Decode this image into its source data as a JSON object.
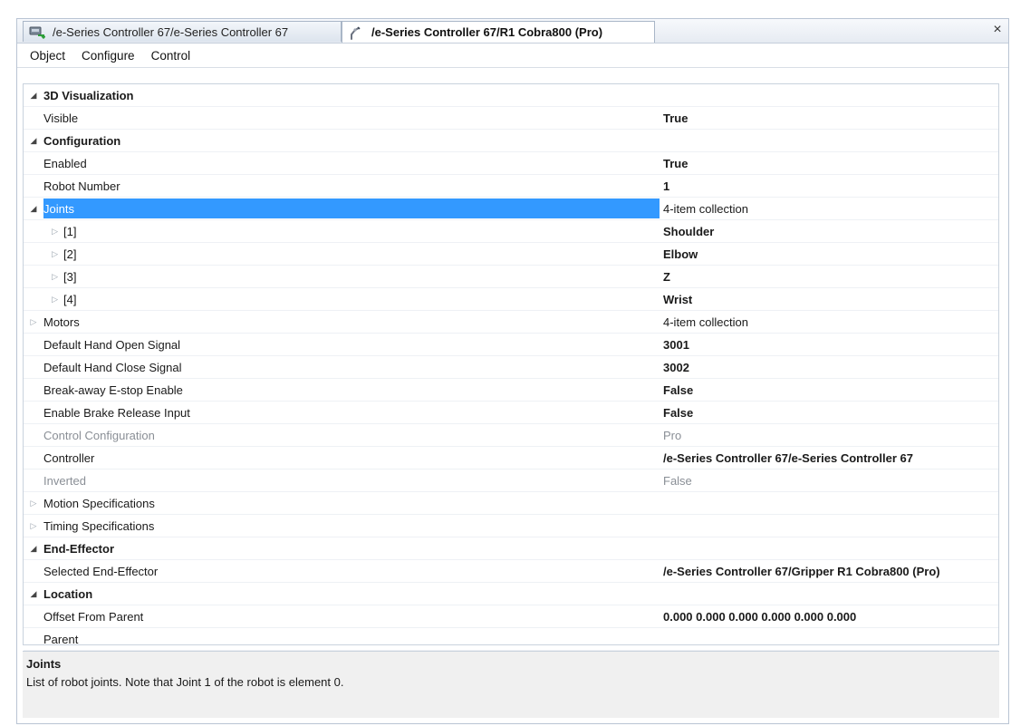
{
  "tabs": [
    {
      "label": "/e-Series Controller 67/e-Series Controller 67",
      "icon": "controller-icon",
      "active": false
    },
    {
      "label": "/e-Series Controller 67/R1 Cobra800 (Pro)",
      "icon": "robot-arm-icon",
      "active": true
    }
  ],
  "close_label": "×",
  "menu": [
    "Object",
    "Configure",
    "Control"
  ],
  "grid": {
    "rows": [
      {
        "name": "3D Visualization",
        "value": "",
        "kind": "category",
        "glyph": "expanded"
      },
      {
        "name": "Visible",
        "value": "True",
        "kind": "property",
        "value_style": "bold"
      },
      {
        "name": "Configuration",
        "value": "",
        "kind": "category",
        "glyph": "expanded"
      },
      {
        "name": "Enabled",
        "value": "True",
        "kind": "property",
        "value_style": "bold"
      },
      {
        "name": "Robot Number",
        "value": "1",
        "kind": "property",
        "value_style": "bold"
      },
      {
        "name": "Joints",
        "value": "4-item collection",
        "kind": "selected",
        "glyph": "expanded"
      },
      {
        "name": "[1]",
        "value": "Shoulder",
        "kind": "sub",
        "value_style": "bold"
      },
      {
        "name": "[2]",
        "value": "Elbow",
        "kind": "sub",
        "value_style": "bold"
      },
      {
        "name": "[3]",
        "value": "Z",
        "kind": "sub",
        "value_style": "bold"
      },
      {
        "name": "[4]",
        "value": "Wrist",
        "kind": "sub",
        "value_style": "bold"
      },
      {
        "name": "Motors",
        "value": "4-item collection",
        "kind": "collapsed"
      },
      {
        "name": "Default Hand Open Signal",
        "value": "3001",
        "kind": "property",
        "value_style": "bold"
      },
      {
        "name": "Default Hand Close Signal",
        "value": "3002",
        "kind": "property",
        "value_style": "bold"
      },
      {
        "name": "Break-away E-stop Enable",
        "value": "False",
        "kind": "property",
        "value_style": "bold"
      },
      {
        "name": "Enable Brake Release Input",
        "value": "False",
        "kind": "property",
        "value_style": "bold"
      },
      {
        "name": "Control Configuration",
        "value": "Pro",
        "kind": "property",
        "value_style": "dim"
      },
      {
        "name": "Controller",
        "value": "/e-Series Controller 67/e-Series Controller 67",
        "kind": "property",
        "value_style": "bold"
      },
      {
        "name": "Inverted",
        "value": "False",
        "kind": "property",
        "value_style": "dim"
      },
      {
        "name": "Motion Specifications",
        "value": "",
        "kind": "collapsed"
      },
      {
        "name": "Timing Specifications",
        "value": "",
        "kind": "collapsed"
      },
      {
        "name": "End-Effector",
        "value": "",
        "kind": "category",
        "glyph": "expanded"
      },
      {
        "name": "Selected End-Effector",
        "value": "/e-Series Controller 67/Gripper R1 Cobra800 (Pro)",
        "kind": "property",
        "value_style": "bold"
      },
      {
        "name": "Location",
        "value": "",
        "kind": "category",
        "glyph": "expanded"
      },
      {
        "name": "Offset From Parent",
        "value": "0.000 0.000 0.000 0.000 0.000 0.000",
        "kind": "property",
        "value_style": "bold"
      },
      {
        "name": "Parent",
        "value": "",
        "kind": "property",
        "value_style": "bold"
      }
    ]
  },
  "description": {
    "title": "Joints",
    "text": "List of robot joints. Note that Joint 1 of the robot is element 0."
  },
  "colors": {
    "selection": "#3399ff",
    "dim_text": "#8a8f96"
  }
}
